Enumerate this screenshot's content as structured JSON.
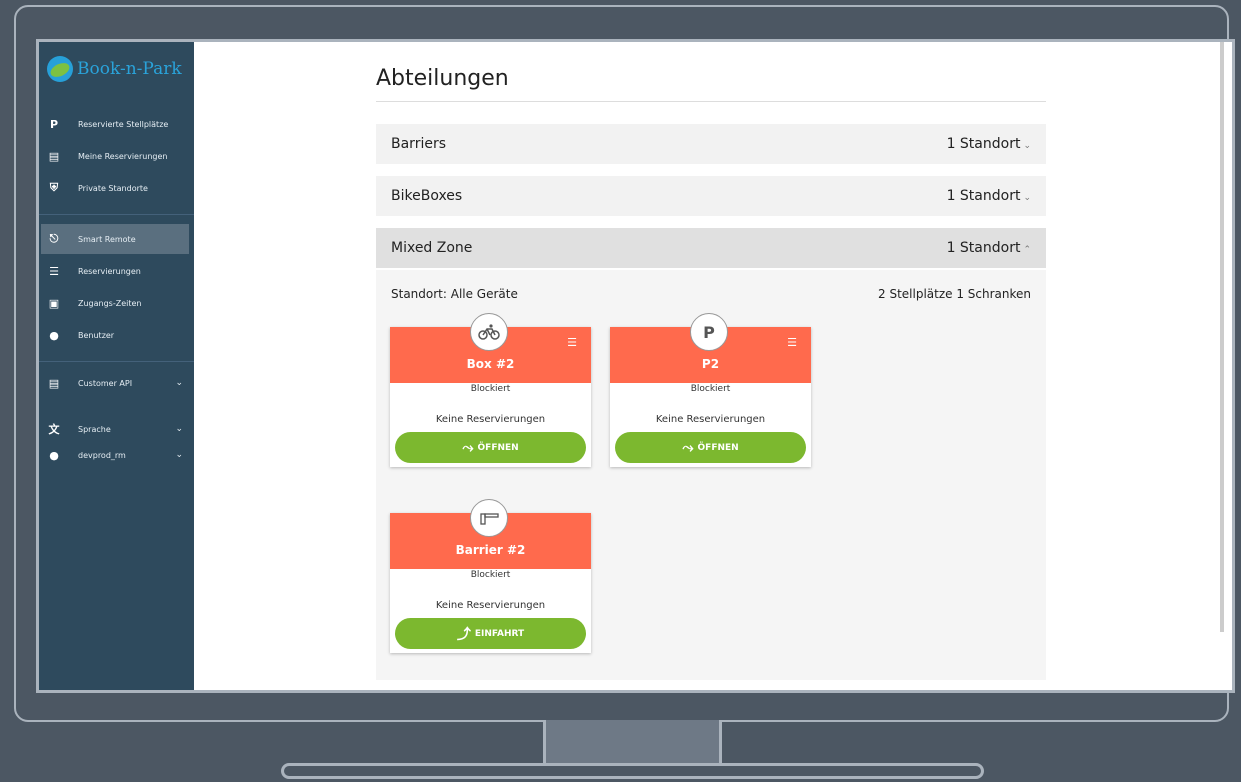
{
  "app": {
    "name": "Book-n-Park"
  },
  "sidebar": {
    "items": [
      {
        "label": "Reservierte Stellplätze",
        "icon": "parking-icon"
      },
      {
        "label": "Meine Reservierungen",
        "icon": "calendar-clock-icon"
      },
      {
        "label": "Private Standorte",
        "icon": "shield-icon"
      },
      {
        "label": "Smart Remote",
        "icon": "remote-icon",
        "active": true
      },
      {
        "label": "Reservierungen",
        "icon": "list-icon"
      },
      {
        "label": "Zugangs-Zeiten",
        "icon": "calendar-icon"
      },
      {
        "label": "Benutzer",
        "icon": "users-icon"
      },
      {
        "label": "Customer API",
        "icon": "document-icon"
      },
      {
        "label": "Sprache",
        "icon": "translate-icon"
      },
      {
        "label": "devprod_rm",
        "icon": "user-icon"
      }
    ]
  },
  "main": {
    "title": "Abteilungen",
    "departments": [
      {
        "name": "Barriers",
        "count": "1 Standort",
        "expanded": false
      },
      {
        "name": "BikeBoxes",
        "count": "1 Standort",
        "expanded": false
      },
      {
        "name": "Mixed Zone",
        "count": "1 Standort",
        "expanded": true
      }
    ],
    "location": {
      "label": "Standort: Alle Geräte",
      "summary": "2 Stellplätze 1 Schranken"
    },
    "devices": [
      {
        "name": "Box #2",
        "status": "Blockiert",
        "reservations": "Keine Reservierungen",
        "action": "ÖFFNEN",
        "icon": "bike-icon"
      },
      {
        "name": "P2",
        "status": "Blockiert",
        "reservations": "Keine Reservierungen",
        "action": "ÖFFNEN",
        "icon": "parking-icon",
        "icon_text": "P"
      },
      {
        "name": "Barrier #2",
        "status": "Blockiert",
        "reservations": "Keine Reservierungen",
        "action": "EINFAHRT",
        "icon": "barrier-icon"
      }
    ]
  },
  "colors": {
    "sidebar": "#2e4a5d",
    "card_header": "#ff6a4d",
    "action_button": "#7cb82f"
  }
}
